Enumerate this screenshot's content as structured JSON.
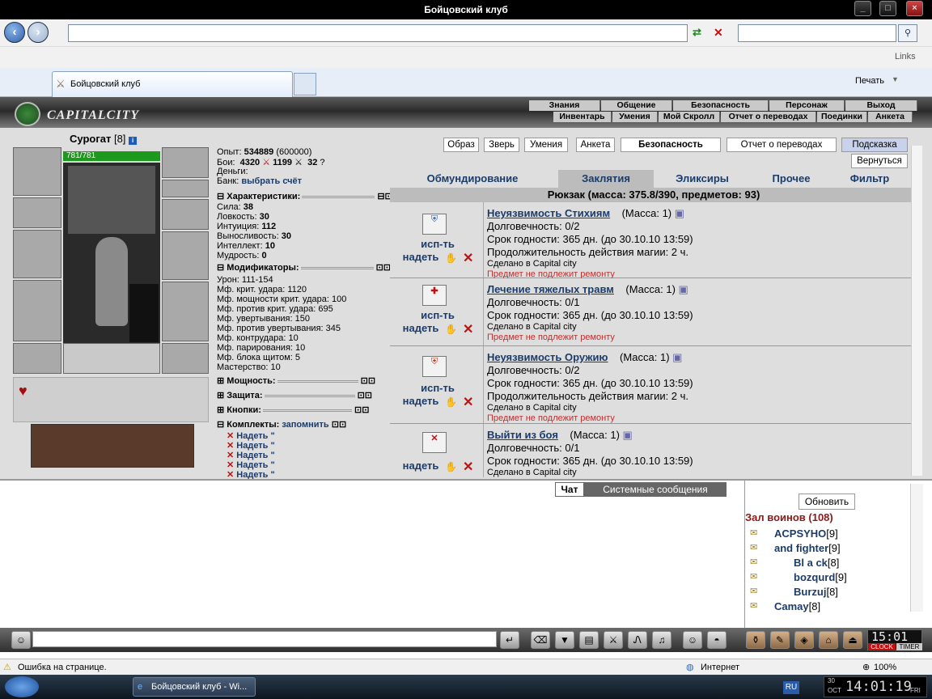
{
  "window": {
    "title": "Бойцовский клуб",
    "controls": [
      "_",
      "□",
      "×"
    ]
  },
  "browser": {
    "links_label": "Links",
    "tab_label": "Бойцовский клуб",
    "print_label": "Печать"
  },
  "game": {
    "logo": "CAPITALCITY",
    "menu_top": [
      "Знания",
      "Общение",
      "Безопасность",
      "Персонаж",
      "Выход"
    ],
    "menu_bottom": [
      "Инвентарь",
      "Умения",
      "Мой Скролл",
      "Отчет о переводах",
      "Поединки",
      "Анкета"
    ]
  },
  "character": {
    "name": "Сурогат",
    "level": "[8]",
    "hp": "781/781",
    "exp_label": "Опыт:",
    "exp_value": "534889",
    "exp_next": "(600000)",
    "fights_label": "Бои:",
    "wins": "4320",
    "losses": "1199",
    "draws": "32",
    "money_label": "Деньги:",
    "bank_label": "Банк:",
    "bank_link": "выбрать счёт"
  },
  "sections": {
    "characteristics": "Характеристики:",
    "modifiers": "Модификаторы:",
    "powers": "Мощность:",
    "protection": "Защита:",
    "buttons": "Кнопки:",
    "sets": "Комплекты:",
    "remember": "запомнить"
  },
  "stats": [
    {
      "label": "Сила:",
      "value": "38"
    },
    {
      "label": "Ловкость:",
      "value": "30"
    },
    {
      "label": "Интуиция:",
      "value": "112"
    },
    {
      "label": "Выносливость:",
      "value": "30"
    },
    {
      "label": "Интеллект:",
      "value": "10"
    },
    {
      "label": "Мудрость:",
      "value": "0"
    }
  ],
  "modifiers": [
    "Урон: 111-154",
    "Мф. крит. удара: 1120",
    "Мф. мощности крит. удара: 100",
    "Мф. против крит. удара: 695",
    "Мф. увертывания: 150",
    "Мф. против увертывания: 345",
    "Мф. контрудара: 10",
    "Мф. парирования: 10",
    "Мф. блока щитом: 5",
    "Мастерство: 10"
  ],
  "sets_list": [
    "Надеть \"",
    "Надеть \"",
    "Надеть \"",
    "Надеть \"",
    "Надеть \""
  ],
  "top_buttons": [
    "Образ",
    "Зверь",
    "Умения",
    "Анкета",
    "Безопасность",
    "Отчет о переводах",
    "Подсказка"
  ],
  "back_button": "Вернуться",
  "category_tabs": [
    "Обмундирование",
    "Заклятия",
    "Эликсиры",
    "Прочее",
    "Фильтр"
  ],
  "active_tab": "Заклятия",
  "rucksack": "Рюкзак (масса: 375.8/390, предметов: 93)",
  "actions": {
    "use": "исп-ть",
    "equip": "надеть"
  },
  "items": [
    {
      "name": "Неуязвимость Стихиям",
      "mass": "(Масса: 1)",
      "durability": "Долговечность: 0/2",
      "expiry": "Срок годности: 365 дн. (до 30.10.10 13:59)",
      "duration": "Продолжительность действия магии: 2 ч.",
      "made": "Сделано в Capital city",
      "repair": "Предмет не подлежит ремонту"
    },
    {
      "name": "Лечение тяжелых травм",
      "mass": "(Масса: 1)",
      "durability": "Долговечность: 0/1",
      "expiry": "Срок годности: 365 дн. (до 30.10.10 13:59)",
      "duration": "",
      "made": "Сделано в Capital city",
      "repair": "Предмет не подлежит ремонту"
    },
    {
      "name": "Неуязвимость Оружию",
      "mass": "(Масса: 1)",
      "durability": "Долговечность: 0/2",
      "expiry": "Срок годности: 365 дн. (до 30.10.10 13:59)",
      "duration": "Продолжительность действия магии: 2 ч.",
      "made": "Сделано в Capital city",
      "repair": "Предмет не подлежит ремонту"
    },
    {
      "name": "Выйти из боя",
      "mass": "(Масса: 1)",
      "durability": "Долговечность: 0/1",
      "expiry": "Срок годности: 365 дн. (до 30.10.10 13:59)",
      "duration": "",
      "made": "Сделано в Capital city",
      "repair": ""
    }
  ],
  "chat": {
    "tab_chat": "Чат",
    "tab_system": "Системные сообщения"
  },
  "online": {
    "refresh": "Обновить",
    "room": "Зал воинов (108)",
    "users": [
      {
        "name": "ACPSYHO",
        "level": "[9]"
      },
      {
        "name": "and fighter",
        "level": "[9]"
      },
      {
        "name": "Bl a ck",
        "level": "[8]"
      },
      {
        "name": "bozqurd",
        "level": "[9]"
      },
      {
        "name": "Burzuj",
        "level": "[8]"
      },
      {
        "name": "Camay",
        "level": "[8]"
      }
    ]
  },
  "clock": {
    "time": "15:01",
    "clock_label": "CLOCK",
    "timer_label": "TIMER"
  },
  "status": {
    "error": "Ошибка на странице.",
    "zone": "Интернет",
    "zoom": "100%"
  },
  "taskbar": {
    "window": "Бойцовский клуб - Wi...",
    "lang": "RU",
    "date_day": "30",
    "date_month": "OCT",
    "time": "14:01:19",
    "weekday": "FRI"
  }
}
